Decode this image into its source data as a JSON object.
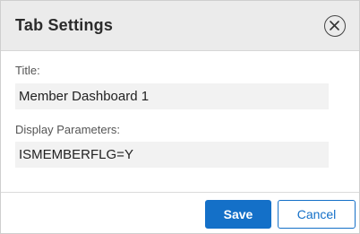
{
  "dialog": {
    "title": "Tab Settings",
    "close_icon": "close-circle-icon"
  },
  "fields": {
    "title": {
      "label": "Title:",
      "value": "Member Dashboard 1"
    },
    "display_parameters": {
      "label": "Display Parameters:",
      "value": "ISMEMBERFLG=Y"
    }
  },
  "footer": {
    "save_label": "Save",
    "cancel_label": "Cancel"
  },
  "colors": {
    "primary": "#1470c8",
    "header_bg": "#ebebeb",
    "input_bg": "#f2f2f2"
  }
}
